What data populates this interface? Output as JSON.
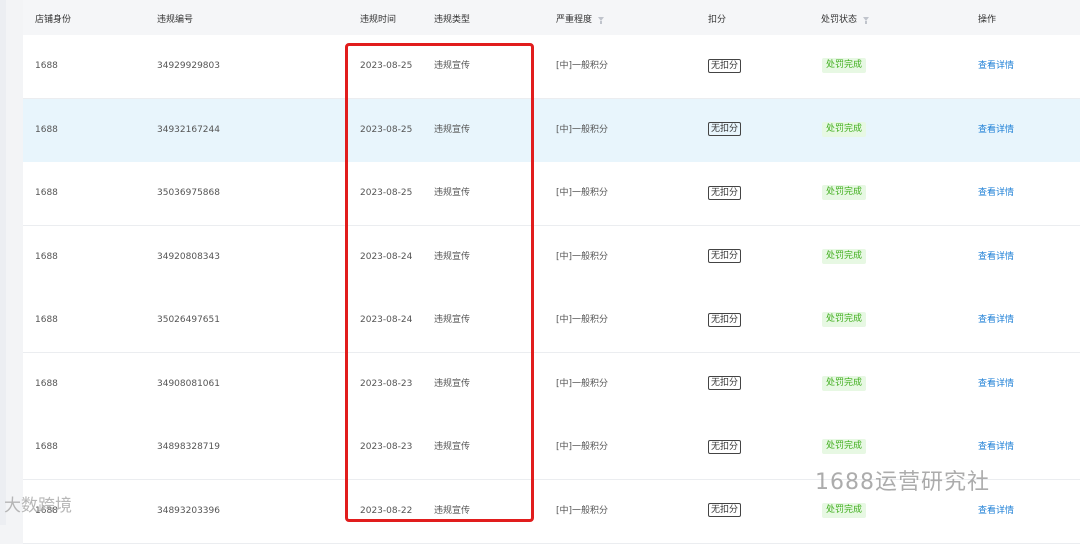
{
  "headers": {
    "shop_identity": "店铺身份",
    "violation_no": "违规编号",
    "violation_time": "违规时间",
    "violation_type": "违规类型",
    "severity": "严重程度",
    "deduction": "扣分",
    "penalty_status": "处罚状态",
    "action": "操作"
  },
  "rows": [
    {
      "shop": "1688",
      "id": "34929929803",
      "date": "2023-08-25",
      "type": "违规宣传",
      "severity": "[中]一般积分",
      "deduction": "无扣分",
      "status": "处罚完成",
      "action": "查看详情"
    },
    {
      "shop": "1688",
      "id": "34932167244",
      "date": "2023-08-25",
      "type": "违规宣传",
      "severity": "[中]一般积分",
      "deduction": "无扣分",
      "status": "处罚完成",
      "action": "查看详情"
    },
    {
      "shop": "1688",
      "id": "35036975868",
      "date": "2023-08-25",
      "type": "违规宣传",
      "severity": "[中]一般积分",
      "deduction": "无扣分",
      "status": "处罚完成",
      "action": "查看详情"
    },
    {
      "shop": "1688",
      "id": "34920808343",
      "date": "2023-08-24",
      "type": "违规宣传",
      "severity": "[中]一般积分",
      "deduction": "无扣分",
      "status": "处罚完成",
      "action": "查看详情"
    },
    {
      "shop": "1688",
      "id": "35026497651",
      "date": "2023-08-24",
      "type": "违规宣传",
      "severity": "[中]一般积分",
      "deduction": "无扣分",
      "status": "处罚完成",
      "action": "查看详情"
    },
    {
      "shop": "1688",
      "id": "34908081061",
      "date": "2023-08-23",
      "type": "违规宣传",
      "severity": "[中]一般积分",
      "deduction": "无扣分",
      "status": "处罚完成",
      "action": "查看详情"
    },
    {
      "shop": "1688",
      "id": "34898328719",
      "date": "2023-08-23",
      "type": "违规宣传",
      "severity": "[中]一般积分",
      "deduction": "无扣分",
      "status": "处罚完成",
      "action": "查看详情"
    },
    {
      "shop": "1688",
      "id": "34893203396",
      "date": "2023-08-22",
      "type": "违规宣传",
      "severity": "[中]一般积分",
      "deduction": "无扣分",
      "status": "处罚完成",
      "action": "查看详情"
    }
  ],
  "hover_row_index": 1,
  "colors": {
    "highlight_box": "#e11d1d",
    "status_text": "#3fae1c",
    "status_bg": "#e7f8e3",
    "link": "#1d7fd6",
    "hover_row": "#e8f5fc"
  },
  "watermark_right": "1688运营研究社",
  "watermark_left": "大数跨境"
}
